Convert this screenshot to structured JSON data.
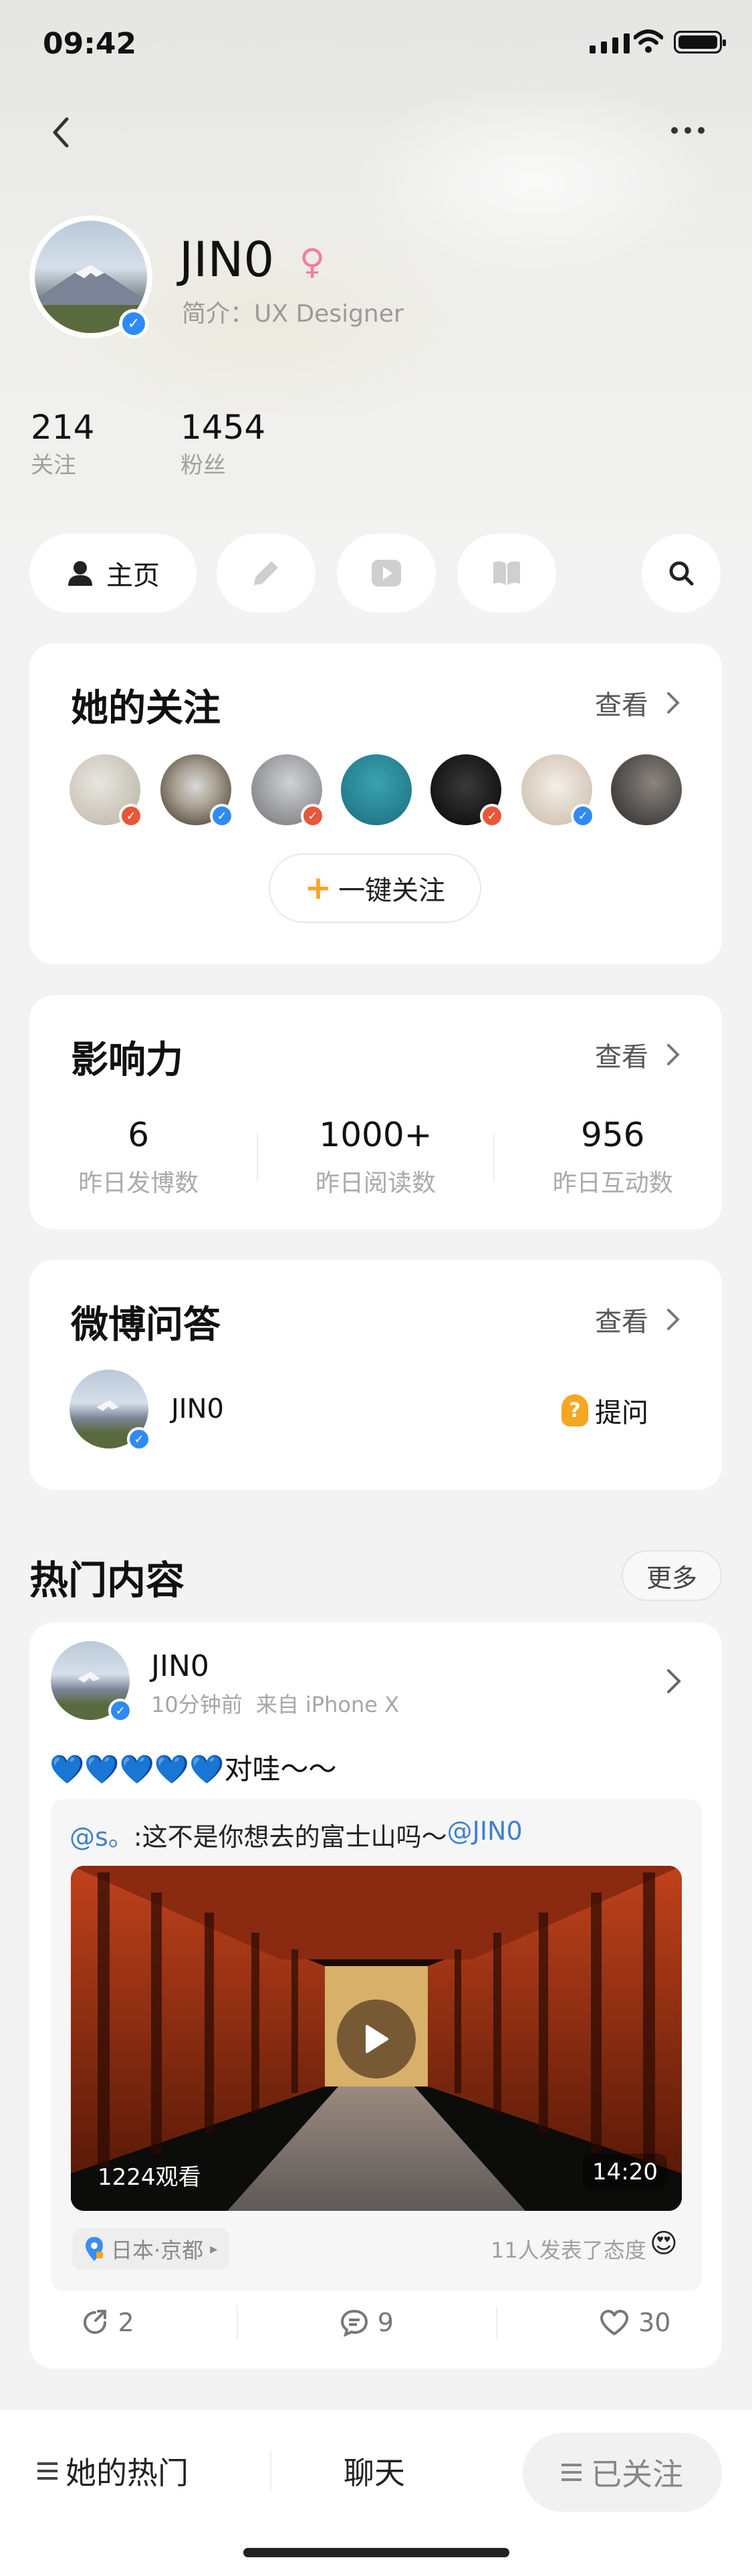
{
  "status_bar": {
    "time": "09:42"
  },
  "profile": {
    "name": "JIN0",
    "gender_symbol": "♀",
    "intro": "简介：UX Designer",
    "following_count": "214",
    "following_label": "关注",
    "followers_count": "1454",
    "followers_label": "粉丝",
    "verified_mark": "✓"
  },
  "tabs": {
    "home_label": "主页"
  },
  "her_follows": {
    "title": "她的关注",
    "see_label": "查看",
    "follow_all_plus": "+",
    "follow_all_label": "一键关注"
  },
  "influence": {
    "title": "影响力",
    "see_label": "查看",
    "metrics": [
      {
        "value": "6",
        "label": "昨日发博数"
      },
      {
        "value": "1000+",
        "label": "昨日阅读数"
      },
      {
        "value": "956",
        "label": "昨日互动数"
      }
    ]
  },
  "qa": {
    "title": "微博问答",
    "see_label": "查看",
    "user_name": "JIN0",
    "ask_label": "提问",
    "ask_glyph": "?"
  },
  "hot": {
    "title": "热门内容",
    "more_label": "更多"
  },
  "post": {
    "author": "JIN0",
    "time": "10分钟前",
    "source": "来自 iPhone X",
    "text": "💙💙💙💙💙对哇～～",
    "quote_user": "@s。",
    "quote_text": ":这不是你想去的富士山吗～",
    "quote_mention": "@JIN0",
    "video_views": "1224观看",
    "video_duration": "14:20",
    "location": "日本·京都",
    "reactions_text": "11人发表了态度",
    "reaction_emoji": "😍",
    "repost_count": "2",
    "comment_count": "9",
    "like_count": "30"
  },
  "bottom_bar": {
    "her_hot_label": "她的热门",
    "chat_label": "聊天",
    "followed_label": "已关注"
  },
  "colors": {
    "verified_blue": "#2f8af5",
    "verified_red": "#e8573a",
    "link_blue": "#3f7fd1",
    "plus_orange": "#f5a623",
    "female_pink": "#f07ea0"
  }
}
